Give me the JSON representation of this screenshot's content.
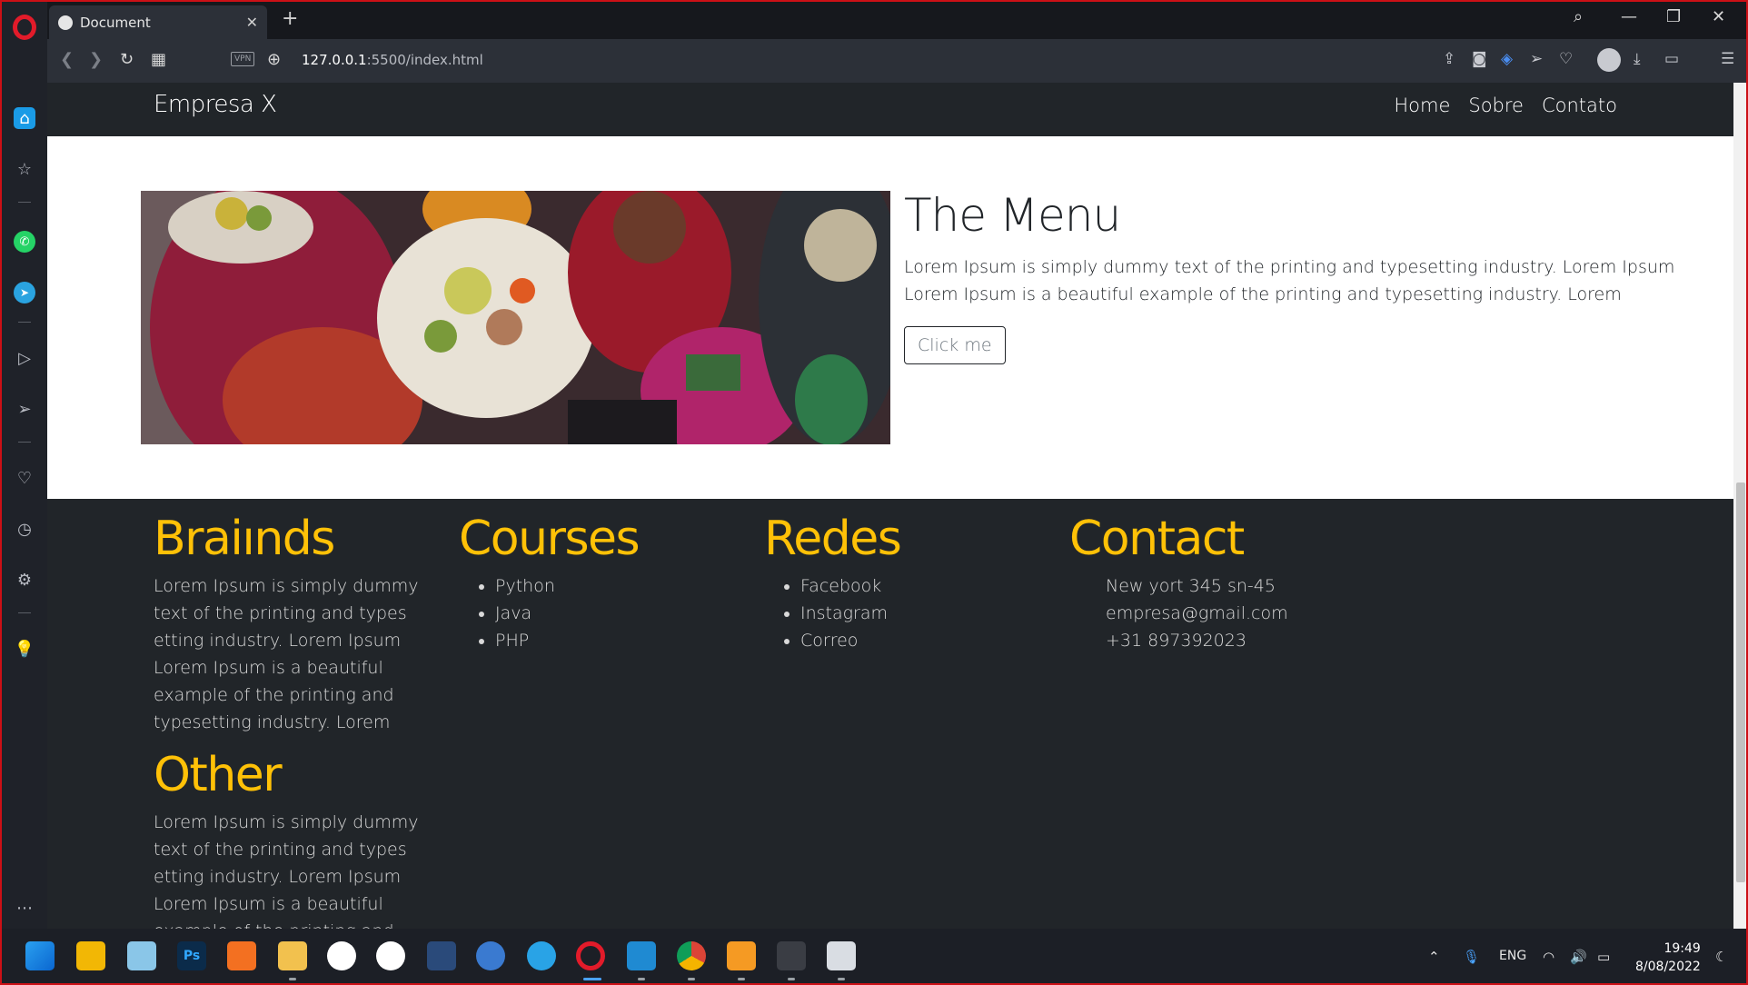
{
  "browser": {
    "tab_title": "Document",
    "url_host": "127.0.0.1",
    "url_path": ":5500/index.html",
    "vpn_label": "VPN"
  },
  "site": {
    "brand": "Empresa X",
    "nav": [
      "Home",
      "Sobre",
      "Contato"
    ]
  },
  "hero": {
    "title": "The Menu",
    "line1": "Lorem Ipsum is simply dummy text of the printing and typesetting industry. Lorem Ipsum",
    "line2": "Lorem Ipsum is a beautiful example of the printing and typesetting industry. Lorem",
    "button": "Click me"
  },
  "footer": {
    "braids": {
      "title": "Braiınds",
      "text": "Lorem Ipsum is simply dummy text of the printing and types etting industry. Lorem Ipsum Lorem Ipsum is a beautiful example of the printing and typesetting industry. Lorem"
    },
    "courses": {
      "title": "Courses",
      "items": [
        "Python",
        "Java",
        "PHP"
      ]
    },
    "redes": {
      "title": "Redes",
      "items": [
        "Facebook",
        "Instagram",
        "Correo"
      ]
    },
    "contact": {
      "title": "Contact",
      "address": "New yort 345 sn-45",
      "email": "empresa@gmail.com",
      "phone": "+31 897392023"
    },
    "other": {
      "title": "Other",
      "text": "Lorem Ipsum is simply dummy text of the printing and types etting industry. Lorem Ipsum Lorem Ipsum is a beautiful example of the printing and typesetting industry."
    }
  },
  "taskbar": {
    "language": "ENG",
    "time": "19:49",
    "date": "8/08/2022"
  },
  "colors": {
    "accent_yellow": "#ffc107",
    "dark_bg": "#212529",
    "opera_red": "#e21b2a"
  }
}
